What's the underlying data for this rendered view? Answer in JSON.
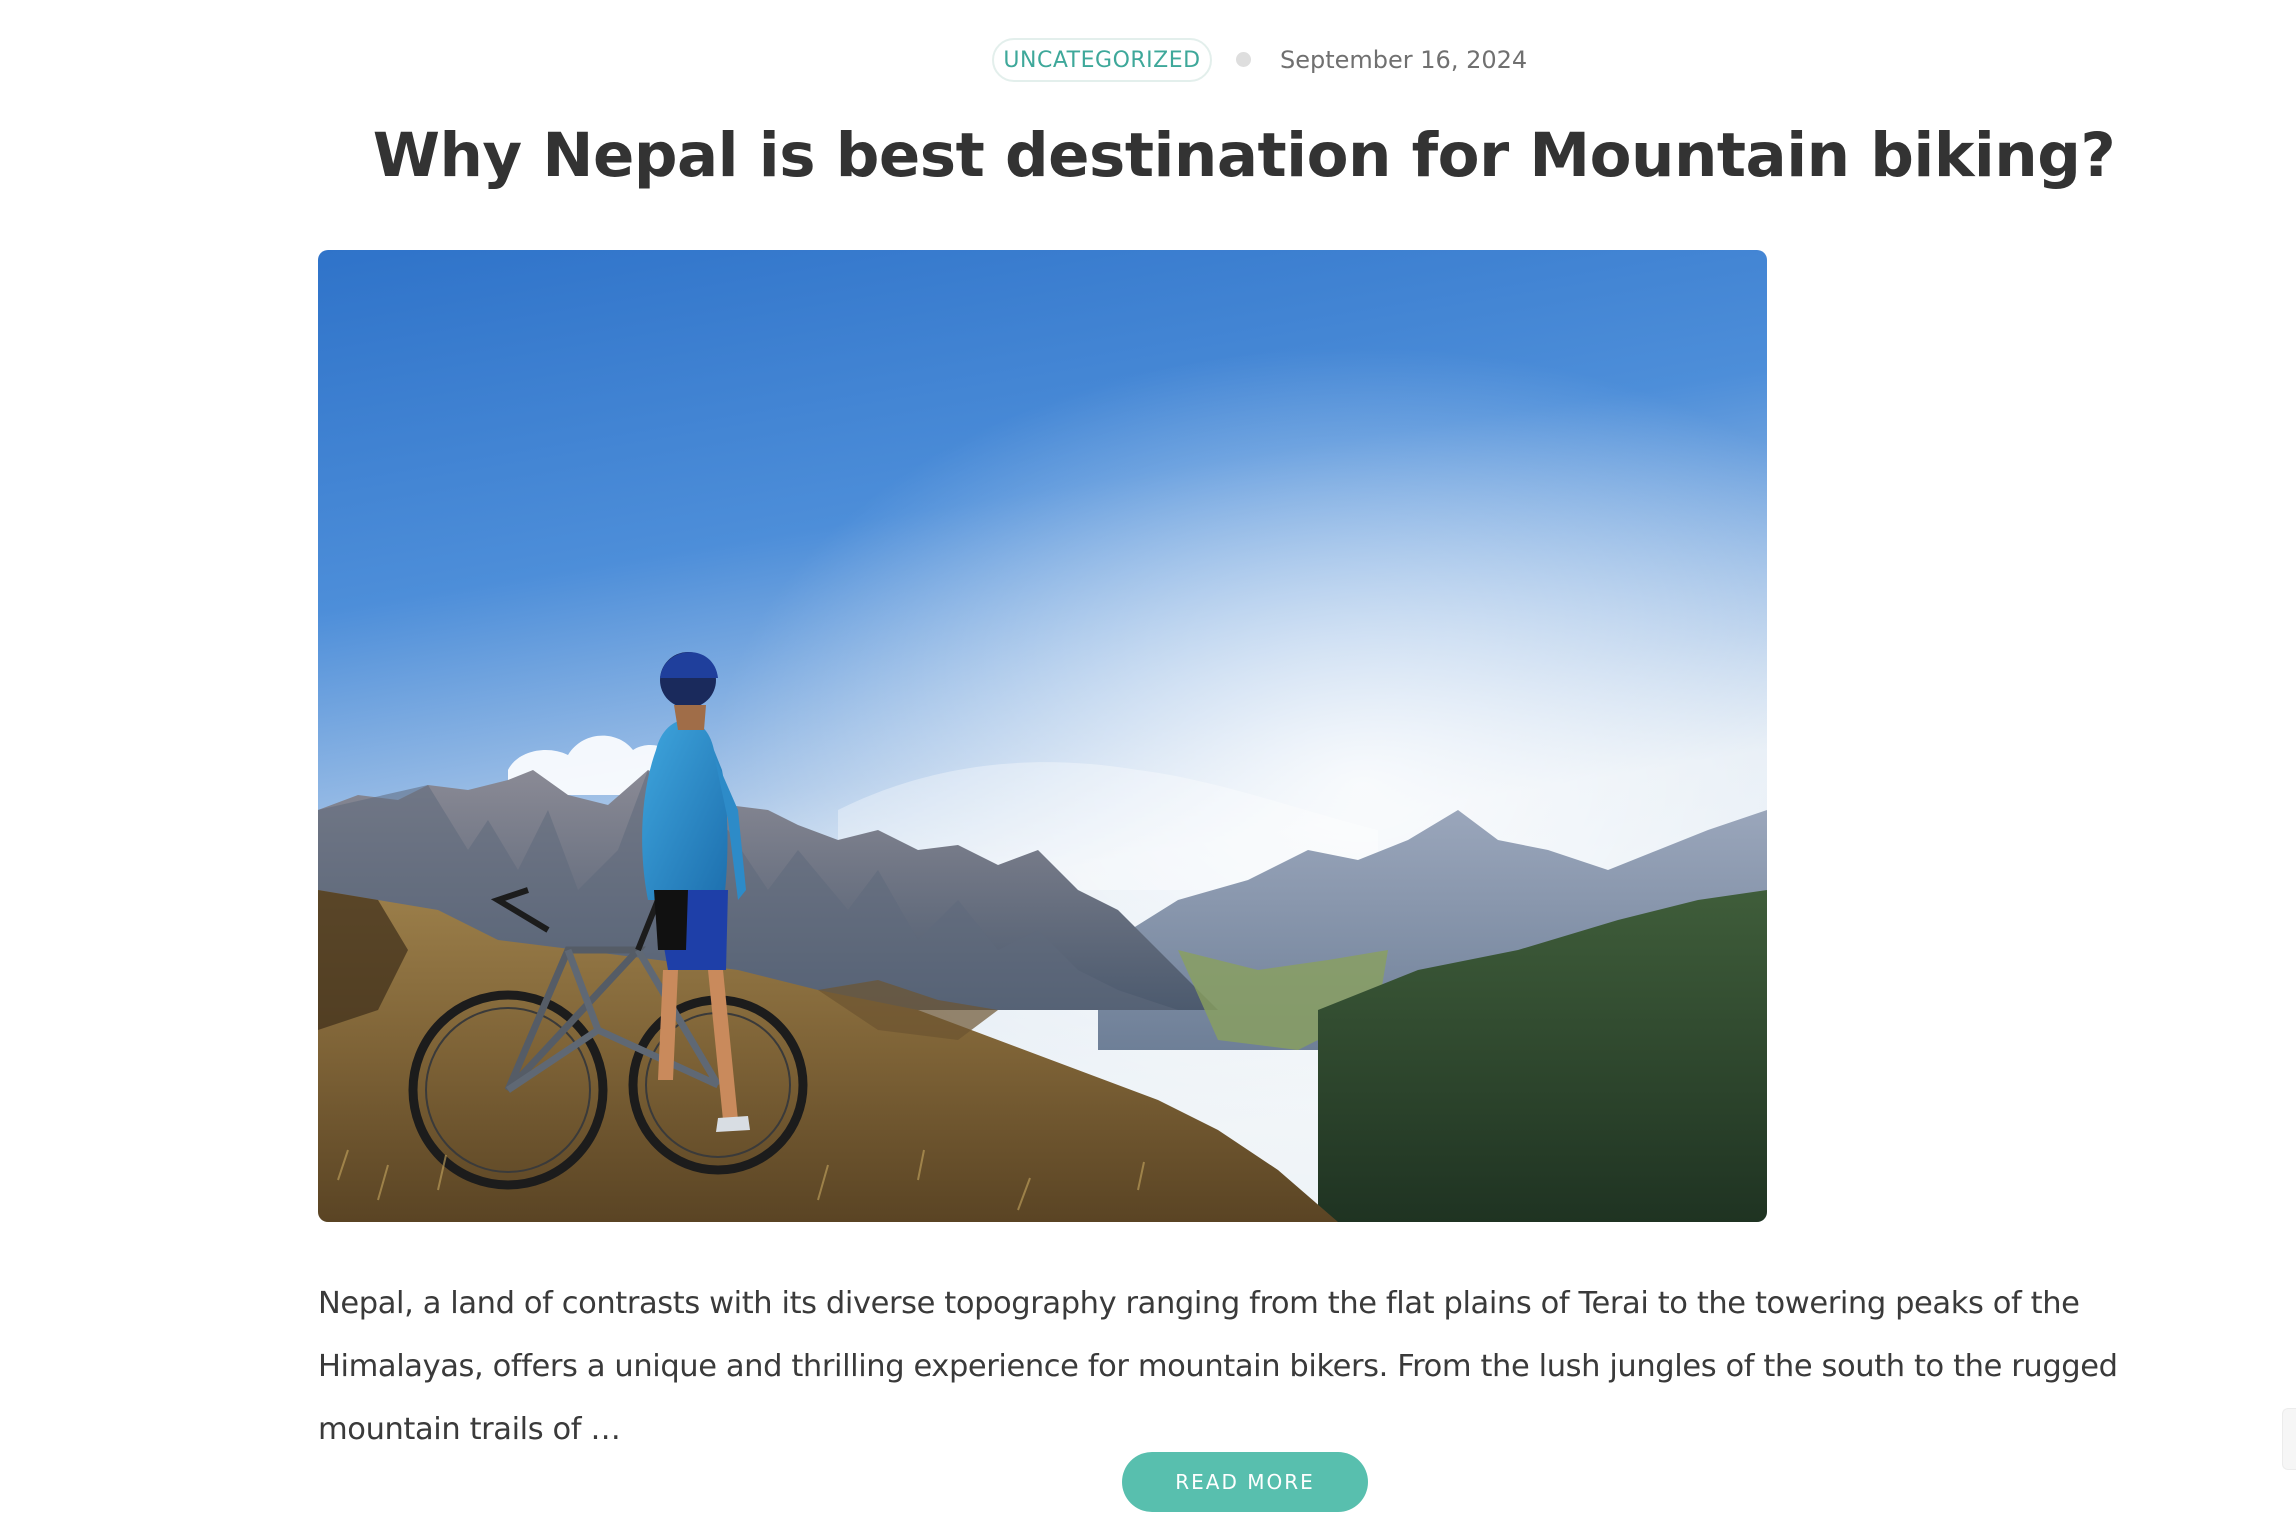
{
  "post": {
    "category": "UNCATEGORIZED",
    "date": "September 16, 2024",
    "title": "Why Nepal is best destination for Mountain biking?",
    "image_description": "Cyclist in blue jacket and helmet standing with mountain bike on grassy ridge overlooking an alpine valley with jagged mountain peaks under a blue sky",
    "excerpt": "Nepal, a land of contrasts with its diverse topography ranging from the flat plains of Terai to the towering peaks of the Himalayas, offers a unique and thrilling experience for mountain bikers. From the lush jungles of the south to the rugged mountain trails of …",
    "read_more_label": "READ MORE"
  },
  "colors": {
    "accent": "#58bfae",
    "category_text": "#3ea89a",
    "title_text": "#333333",
    "body_text": "#3a3a3a",
    "meta_text": "#707070"
  }
}
